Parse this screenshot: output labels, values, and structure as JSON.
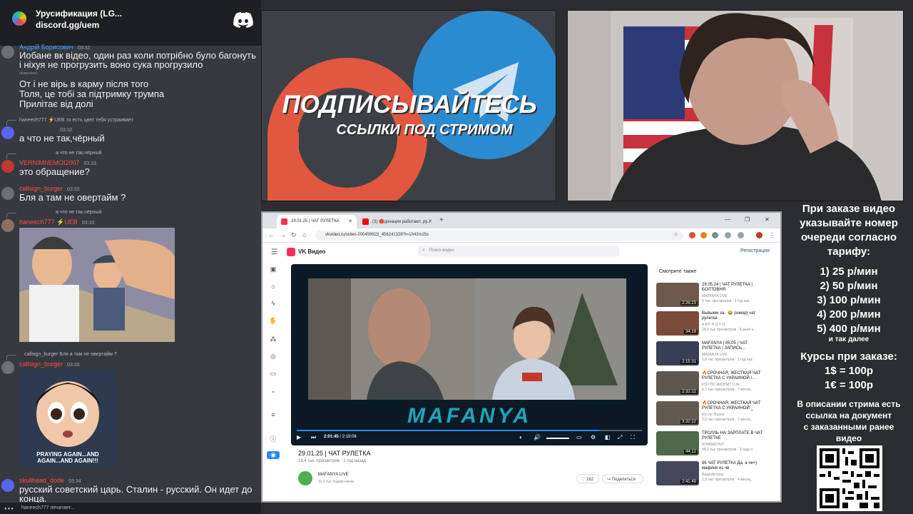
{
  "discord": {
    "server_name": "Урусификация (LG...",
    "server_link": "discord.gg/uem",
    "messages": [
      {
        "user": "Андрій Борисович",
        "time": "03:32",
        "text": "Иобане вк відео, один раз коли потрібно було багонуть і ніхуя не прогрузить воно сука прогрузило",
        "edited": "(изменено)"
      },
      {
        "text": "От і не вірь в карму після того"
      },
      {
        "text": "Толя, це тобі за підтримку трумпа"
      },
      {
        "text": "Прилітає від долі"
      },
      {
        "reply": "haneech777 ⚡UEB  то есть цвет тебя устраивает",
        "user": "",
        "time": "03:32",
        "text": "а что не так,чёрный"
      },
      {
        "reply": "а что не так,чёрный",
        "user": "VERNIMNEMOI2007",
        "time": "03:33",
        "text": "это обращение?"
      },
      {
        "user": "callsign_burger",
        "time": "03:33",
        "text": "Бля а там не овертайм ?"
      },
      {
        "reply": "а что не так,чёрный",
        "user": "haneech777 ⚡UEB",
        "time": "03:33"
      },
      {
        "reply": "callsign_burger Бля а там не овертайм ?",
        "user": "callsign_burger",
        "time": "03:33",
        "caption": "PRAYING AGAIN...AND AGAIN...AND AGAIN!!!"
      },
      {
        "user": "skullhead_dode",
        "time": "03:34",
        "text": "русский советский царь. Сталин - русский. Он идет до конца."
      }
    ],
    "typing": "haneech777 печатает..."
  },
  "banner": {
    "line1": "ПОДПИСЫВАЙТЕСЬ",
    "line2": "ССЫЛКИ ПОД СТРИМОМ"
  },
  "info": {
    "order_text": [
      "При заказе видео",
      "указывайте номер",
      "очереди согласно",
      "тарифу:"
    ],
    "tariffs": [
      "1) 25 р/мин",
      "2) 50 р/мин",
      "3) 100 р/мин",
      "4) 200 р/мин",
      "5) 400 р/мин"
    ],
    "etc": "и так далее",
    "rates_title": "Курсы при заказе:",
    "rates": [
      "1$ = 100р",
      "1€ = 100р"
    ],
    "description": [
      "В описании стрима есть",
      "ссылка на документ",
      "с заказанными ранее",
      "видео"
    ]
  },
  "browser": {
    "tab1": "29.01.25 | ЧАТ РУЛЕТКА",
    "tab2": "(3) 🔴донации работают, ру...",
    "url": "vkvideo.ru/video-200459923_456241328?t=1h42m25s",
    "site_name": "VK Видео",
    "search_placeholder": "Поиск видео",
    "register": "Регистрация",
    "player": {
      "overlay_text": "MAFANYA",
      "time_current": "2:01:45",
      "time_total": "2:19:06",
      "progress": 0.875
    },
    "video_title": "29.01.25 | ЧАТ РУЛЕТКА",
    "video_stats": "19,4 тыс просмотров  ·  1 год назад",
    "channel": "MAFANYA LIVE",
    "subscribers": "11,3 тыс подписчиков",
    "likes": "162",
    "share": "Поделиться",
    "related_header": "Смотрите также",
    "related": [
      {
        "title": "29.05.24 | ЧАТ РУЛЕТКА | БОЛТОВНЯ",
        "channel": "MAFANYA LIVE",
        "stats": "9 тыс просмотров · 1 год наз.",
        "duration": "2:26:23"
      },
      {
        "title": "Вывыем за.. 😂 (юмор) чат рулетка",
        "channel": "A B P H O T O",
        "stats": "20,3 тыс просмотров · 8 дней н.",
        "duration": "34:19"
      },
      {
        "title": "MAFANYA | 05.05 | ЧАТ РУЛЕТКА | ЗАПИСЬ...",
        "channel": "MAFANYA LIVE",
        "stats": "1,6 тыс просмотров · 1 год наз.",
        "duration": "2:15:31"
      },
      {
        "title": "🔥СРОЧНАЯ, ЖЕСТКАЯ ЧАТ РУЛЕТКА С УКРАИНОЙ /...",
        "channel": "КТО ПО ЖИЗНИ? | Life",
        "stats": "6,7 тыс просмотров · 7 месяц.",
        "duration": "2:32:22"
      },
      {
        "title": "🔥СРОЧНАЯ, ЖЕСТКАЯ ЧАТ РУЛЕТКА С УКРАИНОЙ _",
        "channel": "Кто по Жизни",
        "stats": "2,5 тыс просмотров · 7 месяц.",
        "duration": "3:32:22"
      },
      {
        "title": "ТРОЛЛЬ НА ЗАРПЛАТЕ В ЧАТ РУЛЕТКЕ",
        "channel": "БОМБАСТЕР",
        "stats": "44,2 тыс просмотров · 3 года н.",
        "duration": "44:12"
      },
      {
        "title": "96 ЧАТ РУЛЕТКА Да, а че+) мафиня ес чв",
        "channel": "Видеобстрох",
        "stats": "2,3 тыс просмотров · 4 месяц.",
        "duration": "2:41:49"
      }
    ]
  }
}
